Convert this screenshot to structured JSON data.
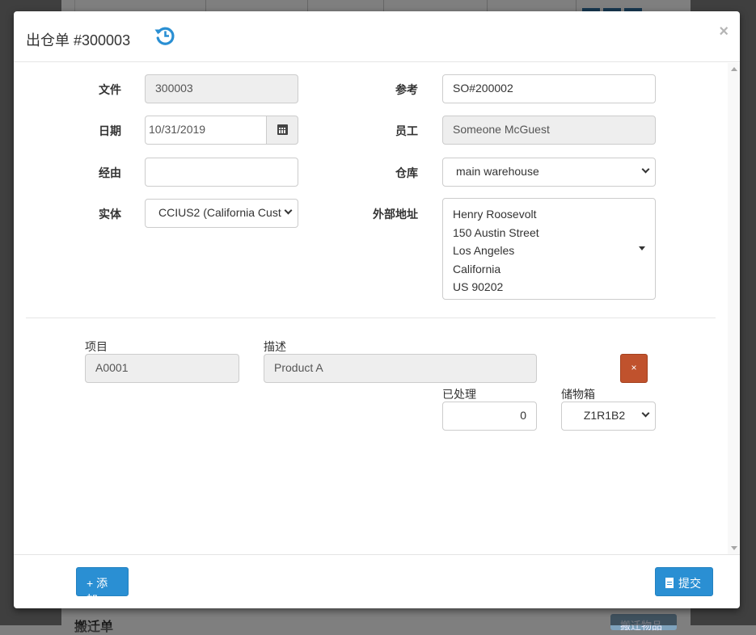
{
  "background": {
    "footer_title": "搬迁单",
    "footer_button": "搬迁物品"
  },
  "modal": {
    "title": "出仓单 #300003",
    "close_label": "×",
    "icons": {
      "history": "history-icon",
      "close": "close-icon",
      "calendar": "calendar-icon",
      "submit": "file-icon"
    },
    "colors": {
      "primary": "#2a8fd3",
      "danger": "#c0522d",
      "readonly_bg": "#eeeeee"
    }
  },
  "form": {
    "document": {
      "label": "文件",
      "value": "300003"
    },
    "date": {
      "label": "日期",
      "value": "10/31/2019"
    },
    "via": {
      "label": "经由",
      "value": ""
    },
    "entity": {
      "label": "实体",
      "value": "CCIUS2 (California Cust"
    },
    "reference": {
      "label": "参考",
      "value": "SO#200002"
    },
    "employee": {
      "label": "员工",
      "value": "Someone McGuest"
    },
    "warehouse": {
      "label": "仓库",
      "value": "main warehouse"
    },
    "external_address": {
      "label": "外部地址",
      "lines": [
        "Henry Roosevolt",
        "150 Austin Street",
        "Los Angeles",
        "California",
        "US 90202"
      ]
    }
  },
  "line_item": {
    "item": {
      "label": "项目",
      "value": "A0001"
    },
    "description": {
      "label": "描述",
      "value": "Product A"
    },
    "delete_label": "×",
    "processed": {
      "label": "已处理",
      "value": "0"
    },
    "bin": {
      "label": "储物箱",
      "value": "Z1R1B2"
    }
  },
  "footer": {
    "add_label": "+ 添加",
    "submit_label": "提交"
  }
}
